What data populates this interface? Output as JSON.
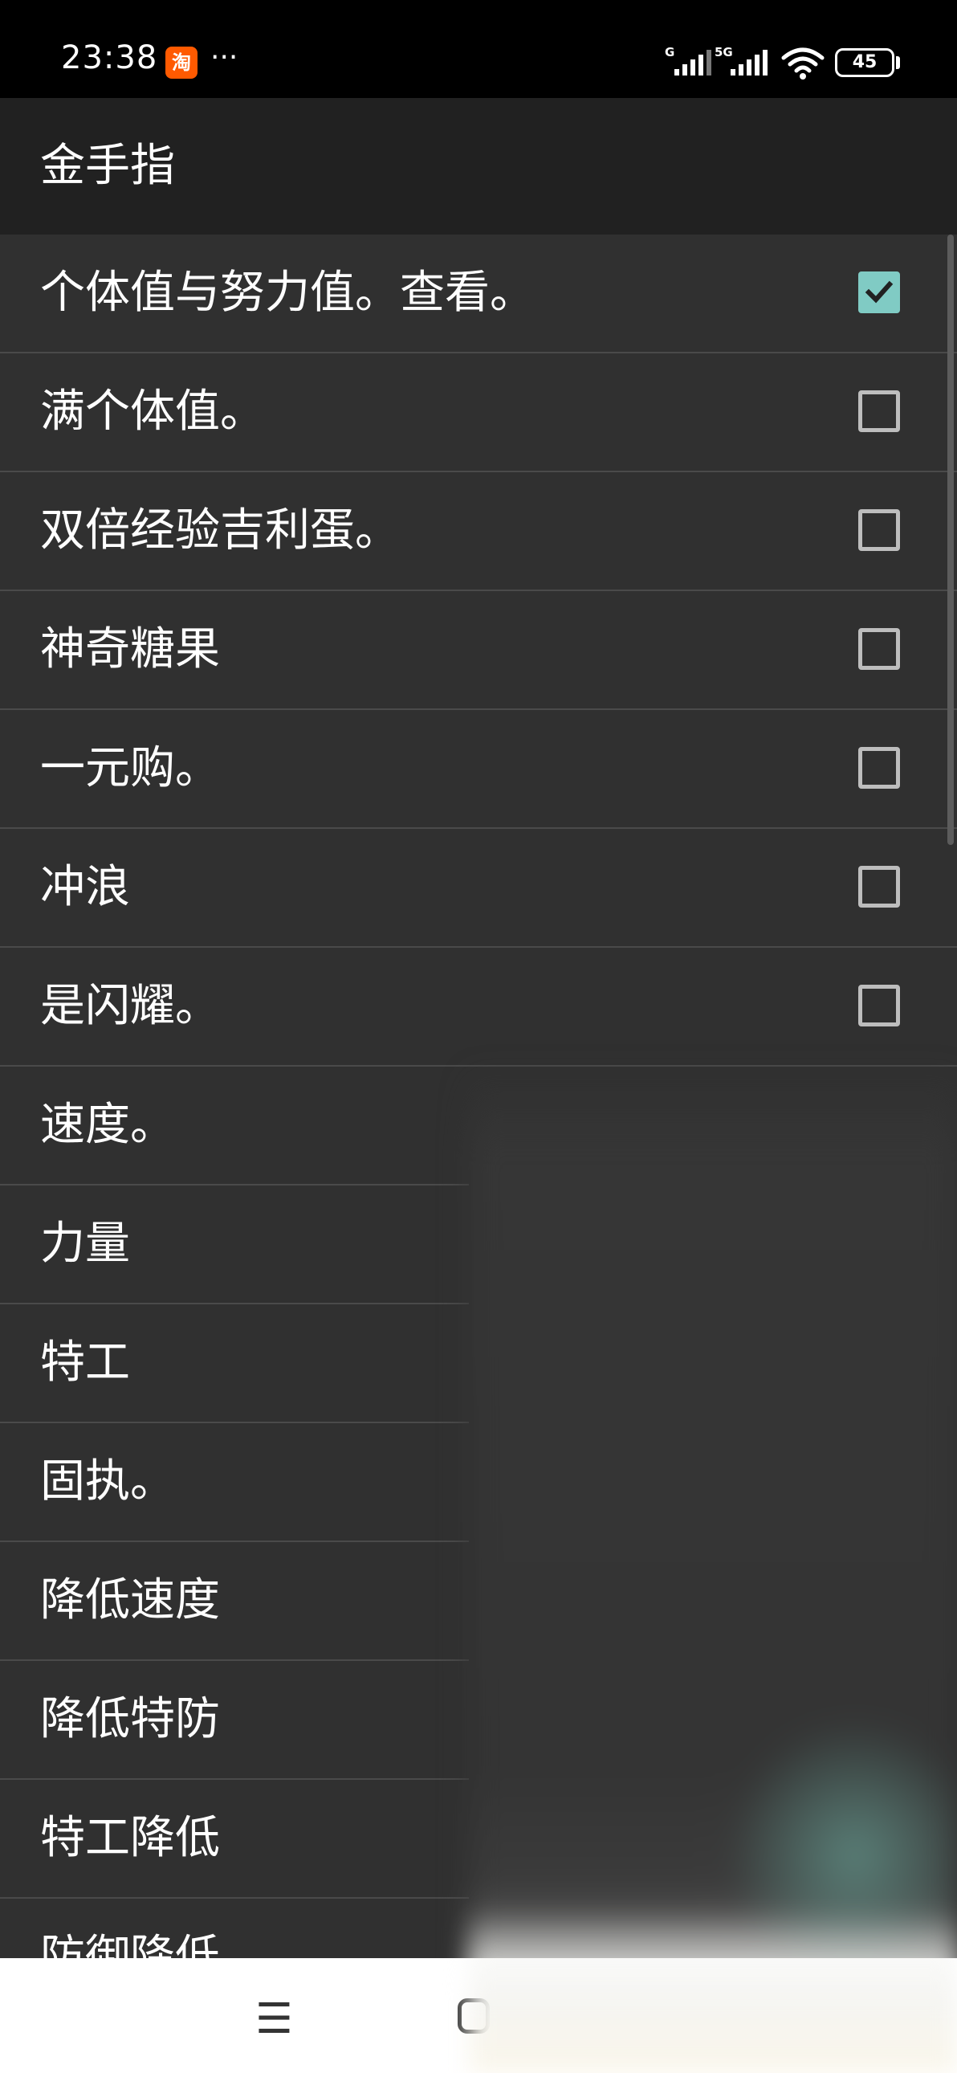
{
  "status_bar": {
    "time": "23:38",
    "taobao_badge": "淘",
    "more": "···",
    "signal_1_label": "G",
    "signal_2_label": "5G",
    "battery": "45"
  },
  "app_bar": {
    "title": "金手指"
  },
  "cheats": [
    {
      "label": "个体值与努力值。查看。",
      "checked": true
    },
    {
      "label": "满个体值。",
      "checked": false
    },
    {
      "label": "双倍经验吉利蛋。",
      "checked": false
    },
    {
      "label": "神奇糖果",
      "checked": false
    },
    {
      "label": "一元购。",
      "checked": false
    },
    {
      "label": "冲浪",
      "checked": false
    },
    {
      "label": "是闪耀。",
      "checked": false
    },
    {
      "label": "速度。"
    },
    {
      "label": "力量"
    },
    {
      "label": "特工"
    },
    {
      "label": "固执。"
    },
    {
      "label": "降低速度"
    },
    {
      "label": "降低特防"
    },
    {
      "label": "特工降低"
    },
    {
      "label": "防御降低"
    }
  ],
  "nav_bar": {
    "menu_glyph": "☰"
  },
  "colors": {
    "background": "#303030",
    "app_bar": "#212121",
    "status_bar": "#000000",
    "checkbox_checked": "#80cbc4",
    "checkbox_unchecked": "#bdbdbd",
    "divider": "#4a4a4a"
  }
}
